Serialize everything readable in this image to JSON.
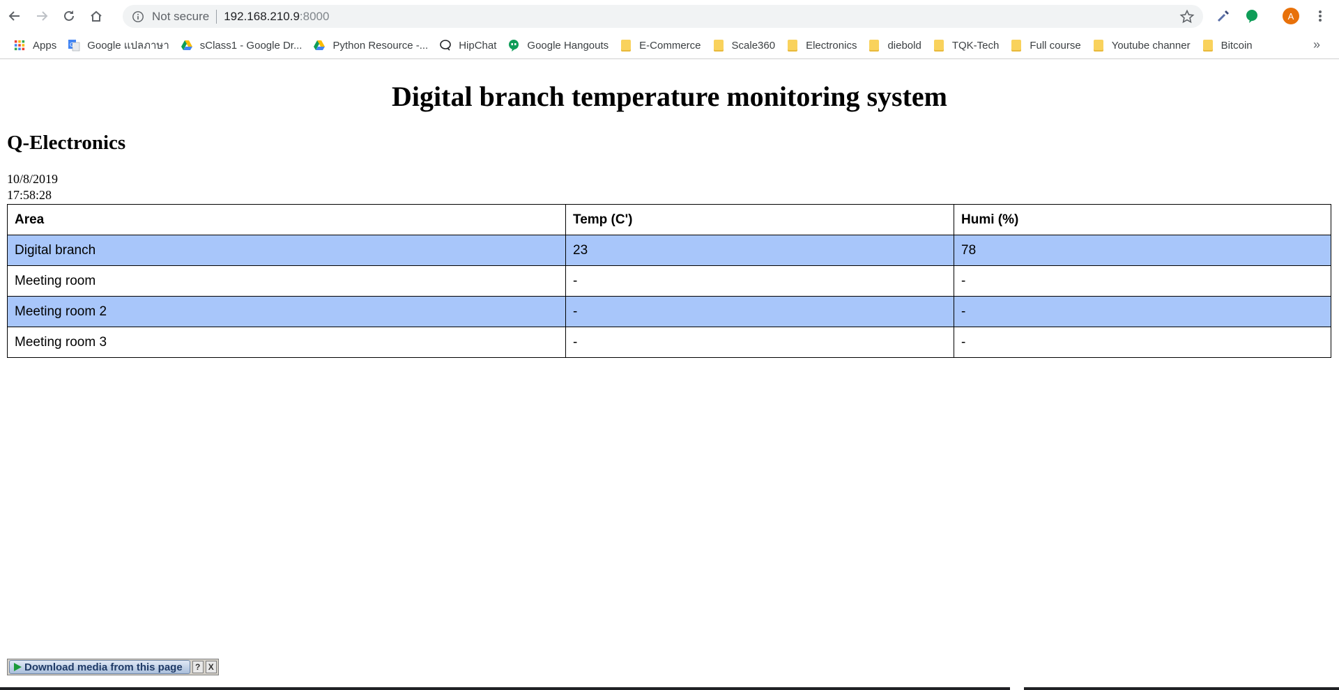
{
  "browser": {
    "security_label": "Not secure",
    "url_host": "192.168.210.9",
    "url_port": ":8000",
    "avatar_letter": "A"
  },
  "bookmarks": {
    "items": [
      {
        "label": "Apps",
        "icon": "apps-grid-icon"
      },
      {
        "label": "Google แปลภาษา",
        "icon": "google-translate-icon"
      },
      {
        "label": "sClass1 - Google Dr...",
        "icon": "google-drive-icon"
      },
      {
        "label": "Python Resource -...",
        "icon": "google-drive-icon"
      },
      {
        "label": "HipChat",
        "icon": "hipchat-icon"
      },
      {
        "label": "Google Hangouts",
        "icon": "hangouts-icon"
      },
      {
        "label": "E-Commerce",
        "icon": "folder-icon"
      },
      {
        "label": "Scale360",
        "icon": "folder-icon"
      },
      {
        "label": "Electronics",
        "icon": "folder-icon"
      },
      {
        "label": "diebold",
        "icon": "folder-icon"
      },
      {
        "label": "TQK-Tech",
        "icon": "folder-icon"
      },
      {
        "label": "Full course",
        "icon": "folder-icon"
      },
      {
        "label": "Youtube channer",
        "icon": "folder-icon"
      },
      {
        "label": "Bitcoin",
        "icon": "folder-icon"
      }
    ],
    "more_label": "»"
  },
  "page": {
    "title": "Digital branch temperature monitoring system",
    "company": "Q-Electronics",
    "date": "10/8/2019",
    "time": "17:58:28"
  },
  "table": {
    "headers": [
      "Area",
      "Temp (C')",
      "Humi (%)"
    ],
    "rows": [
      [
        "Digital branch",
        "23",
        "78"
      ],
      [
        "Meeting room",
        "-",
        "-"
      ],
      [
        "Meeting room 2",
        "-",
        "-"
      ],
      [
        "Meeting room 3",
        "-",
        "-"
      ]
    ],
    "alt_row_color": "#a8c6fa"
  },
  "download_bar": {
    "label": "Download media from this page",
    "help_label": "?",
    "close_label": "X"
  }
}
